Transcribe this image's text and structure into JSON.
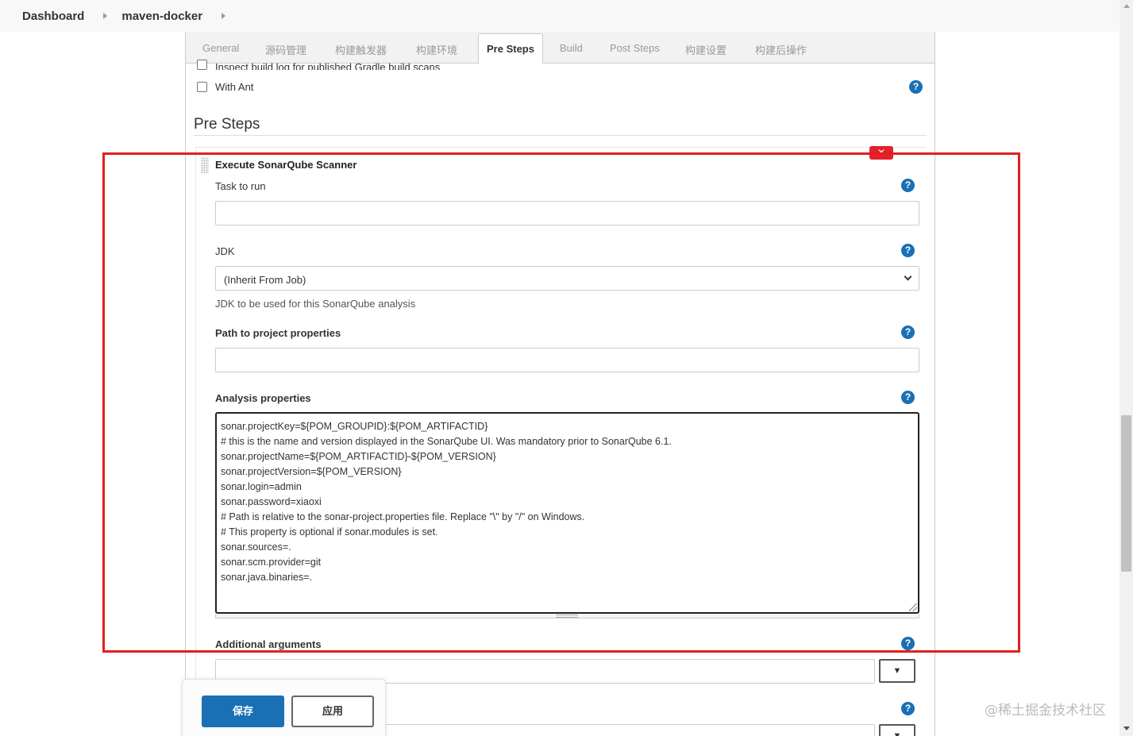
{
  "breadcrumb": {
    "items": [
      {
        "label": "Dashboard"
      },
      {
        "label": "maven-docker"
      }
    ]
  },
  "tabs": [
    {
      "label": "General",
      "active": false
    },
    {
      "label": "源码管理",
      "active": false
    },
    {
      "label": "构建触发器",
      "active": false
    },
    {
      "label": "构建环境",
      "active": false
    },
    {
      "label": "Pre Steps",
      "active": true
    },
    {
      "label": "Build",
      "active": false
    },
    {
      "label": "Post Steps",
      "active": false
    },
    {
      "label": "构建设置",
      "active": false
    },
    {
      "label": "构建后操作",
      "active": false
    }
  ],
  "options": {
    "inspect_gradle": "Inspect build log for published Gradle build scans",
    "with_ant": "With Ant"
  },
  "help_icon_glyph": "?",
  "section": {
    "title": "Pre Steps"
  },
  "builder": {
    "delete_glyph": "✕",
    "title": "Execute SonarQube Scanner",
    "task_label": "Task to run",
    "task_value": "",
    "jdk_label": "JDK",
    "jdk_selected": "(Inherit From Job)",
    "jdk_desc": "JDK to be used for this SonarQube analysis",
    "path_label": "Path to project properties",
    "path_value": "",
    "analysis_label": "Analysis properties",
    "analysis_value": "sonar.projectKey=${POM_GROUPID}:${POM_ARTIFACTID}\n# this is the name and version displayed in the SonarQube UI. Was mandatory prior to SonarQube 6.1.\nsonar.projectName=${POM_ARTIFACTID}-${POM_VERSION}\nsonar.projectVersion=${POM_VERSION}\nsonar.login=admin\nsonar.password=xiaoxi\n# Path is relative to the sonar-project.properties file. Replace \"\\\" by \"/\" on Windows.\n# This property is optional if sonar.modules is set.\nsonar.sources=.\nsonar.scm.provider=git\nsonar.java.binaries=.",
    "additional_label": "Additional arguments",
    "additional_value": "",
    "dropdown_glyph": "▼"
  },
  "actions": {
    "save": "保存",
    "apply": "应用"
  },
  "watermark": "@稀土掘金技术社区",
  "colors": {
    "primary": "#1a6fb5",
    "highlight": "#e02020",
    "delete": "#e5202a"
  }
}
